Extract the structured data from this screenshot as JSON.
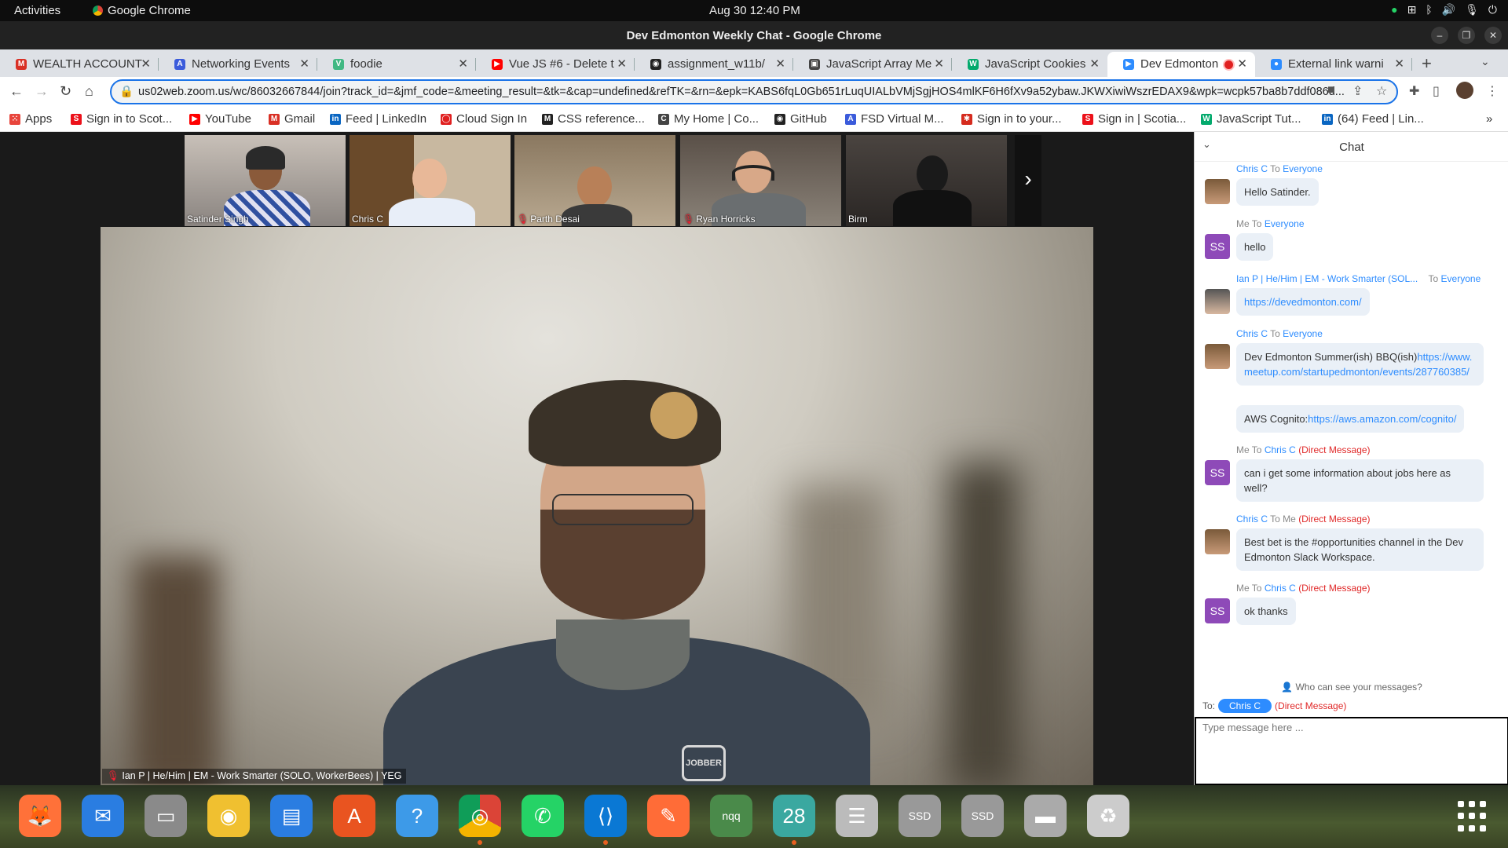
{
  "topbar": {
    "activities": "Activities",
    "app": "Google Chrome",
    "clock": "Aug 30  12:40 PM"
  },
  "window": {
    "title": "Dev Edmonton Weekly Chat - Google Chrome"
  },
  "tabs": [
    {
      "label": "WEALTH ACCOUNT",
      "icon": "gmail-icon",
      "color": "#d93025"
    },
    {
      "label": "Networking Events",
      "icon": "eventbrite-icon",
      "color": "#3b5bdb"
    },
    {
      "label": "foodie",
      "icon": "vue-icon",
      "color": "#41b883"
    },
    {
      "label": "Vue JS #6 - Delete t",
      "icon": "youtube-icon",
      "color": "#ff0000"
    },
    {
      "label": "assignment_w11b/",
      "icon": "github-icon",
      "color": "#222222"
    },
    {
      "label": "JavaScript Array Me",
      "icon": "doc-icon",
      "color": "#444444"
    },
    {
      "label": "JavaScript Cookies",
      "icon": "w3schools-icon",
      "color": "#04aa6d"
    },
    {
      "label": "Dev Edmonton",
      "icon": "zoom-icon",
      "color": "#2d8cff"
    },
    {
      "label": "External link warni",
      "icon": "zoom-icon",
      "color": "#2d8cff"
    }
  ],
  "address": {
    "url": "us02web.zoom.us/wc/86032667844/join?track_id=&jmf_code=&meeting_result=&tk=&cap=undefined&refTK=&rn=&epk=KABS6fqL0Gb651rLuqUIALbVMjSgjHOS4mlKF6H6fXv9a52ybaw.JKWXiwiWszrEDAX9&wpk=wcpk57ba8b7ddf086d..."
  },
  "bookmarks": [
    {
      "label": "Apps",
      "color": "#e8453c"
    },
    {
      "label": "Sign in to Scot...",
      "color": "#ec111a"
    },
    {
      "label": "YouTube",
      "color": "#ff0000"
    },
    {
      "label": "Gmail",
      "color": "#d93025"
    },
    {
      "label": "Feed | LinkedIn",
      "color": "#0a66c2"
    },
    {
      "label": "Cloud Sign In",
      "color": "#e02020"
    },
    {
      "label": "CSS reference...",
      "color": "#222222"
    },
    {
      "label": "My Home | Co...",
      "color": "#444444"
    },
    {
      "label": "GitHub",
      "color": "#222222"
    },
    {
      "label": "FSD Virtual M...",
      "color": "#3b5bdb"
    },
    {
      "label": "Sign in to your...",
      "color": "#d52b1e"
    },
    {
      "label": "Sign in | Scotia...",
      "color": "#ec111a"
    },
    {
      "label": "JavaScript Tut...",
      "color": "#04aa6d"
    },
    {
      "label": "(64) Feed | Lin...",
      "color": "#0a66c2"
    }
  ],
  "participants": [
    {
      "name": "Satinder Singh",
      "muted": false
    },
    {
      "name": "Chris C",
      "muted": false
    },
    {
      "name": "Parth Desai",
      "muted": true
    },
    {
      "name": "Ryan Horricks",
      "muted": true
    },
    {
      "name": "Birm",
      "muted": false
    }
  ],
  "main_video": {
    "label": "Ian P | He/Him | EM - Work Smarter (SOLO, WorkerBees) | YEG",
    "shirt_logo": "JOBBER"
  },
  "chat": {
    "title": "Chat",
    "messages": [
      {
        "from": "Chris C",
        "to_word": "To",
        "to": "Everyone",
        "dm": "",
        "text": "Hello Satinder.",
        "avatar": ""
      },
      {
        "from": "Me",
        "to_word": "To",
        "to": "Everyone",
        "dm": "",
        "text": "hello",
        "avatar": "SS"
      },
      {
        "from": "Ian P | He/Him | EM - Work Smarter (SOL...",
        "to_word": "To",
        "to": "Everyone",
        "dm": "",
        "text": "https://devedmonton.com/",
        "avatar": ""
      },
      {
        "from": "Chris C",
        "to_word": "To",
        "to": "Everyone",
        "dm": "",
        "text_a": "Dev Edmonton Summer(ish) BBQ(ish)",
        "link_a": "https://www.meetup.com/startupedmonton/events/287760385/",
        "text_b": "AWS Cognito:",
        "link_b": "https://aws.amazon.com/cognito/",
        "avatar": ""
      },
      {
        "from": "Me",
        "to_word": "To",
        "to": "Chris C",
        "dm": "(Direct Message)",
        "text": "can i get some information about jobs here as well?",
        "avatar": "SS"
      },
      {
        "from": "Chris C",
        "to_word": "To",
        "to": "Me",
        "dm": "(Direct Message)",
        "text": "Best bet is the #opportunities channel in the Dev Edmonton Slack Workspace.",
        "avatar": ""
      },
      {
        "from": "Me",
        "to_word": "To",
        "to": "Chris C",
        "dm": "(Direct Message)",
        "text": "ok thanks",
        "avatar": "SS"
      }
    ],
    "who_can_see": "Who can see your messages?",
    "to_label": "To:",
    "recipient": "Chris C",
    "recipient_dm": "(Direct Message)",
    "input_placeholder": "Type message here ..."
  },
  "dock": [
    {
      "name": "firefox",
      "color": "#ff7139"
    },
    {
      "name": "thunderbird",
      "color": "#2a7de1"
    },
    {
      "name": "files",
      "color": "#8a8a8a"
    },
    {
      "name": "rhythmbox",
      "color": "#f0c030"
    },
    {
      "name": "libreoffice-writer",
      "color": "#2a7de1"
    },
    {
      "name": "app-center",
      "color": "#e95420"
    },
    {
      "name": "help",
      "color": "#3d9ae8"
    },
    {
      "name": "chrome",
      "color": "#4285f4"
    },
    {
      "name": "whatsapp",
      "color": "#25d366"
    },
    {
      "name": "vscode",
      "color": "#0a78d4"
    },
    {
      "name": "postman",
      "color": "#ff6c37"
    },
    {
      "name": "nqq",
      "color": "#4a8a4a",
      "text": "nqq"
    },
    {
      "name": "calendar",
      "color": "#3aa8a0",
      "text": "28"
    },
    {
      "name": "tasks",
      "color": "#bbbbbb"
    },
    {
      "name": "ssd-1",
      "color": "#999999",
      "text": "SSD"
    },
    {
      "name": "ssd-2",
      "color": "#999999",
      "text": "SSD"
    },
    {
      "name": "drive",
      "color": "#aaaaaa"
    },
    {
      "name": "trash",
      "color": "#cccccc"
    }
  ]
}
